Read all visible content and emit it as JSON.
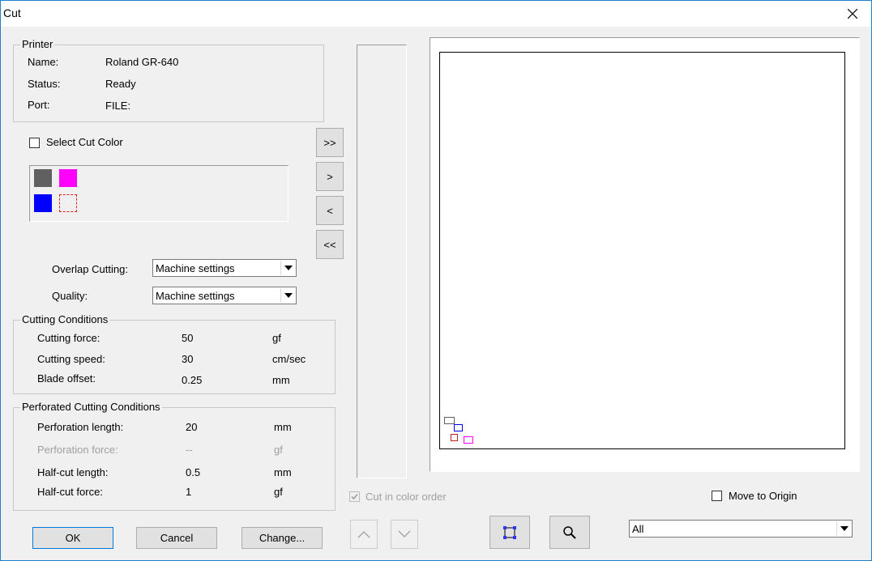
{
  "window": {
    "title": "Cut"
  },
  "printer": {
    "legend": "Printer",
    "rows": [
      {
        "label": "Name:",
        "value": "Roland GR-640"
      },
      {
        "label": "Status:",
        "value": "Ready"
      },
      {
        "label": "Port:",
        "value": "FILE:"
      }
    ]
  },
  "select_cut_color": {
    "label": "Select Cut Color",
    "checked": false
  },
  "colors": {
    "gray": "#606060",
    "magenta": "#ff00ff",
    "blue": "#0000ff",
    "dotted_red": "#e02020"
  },
  "move_buttons": {
    "all_right": ">>",
    "right": ">",
    "left": "<",
    "all_left": "<<"
  },
  "overlap_cutting": {
    "label": "Overlap Cutting:",
    "value": "Machine settings"
  },
  "quality": {
    "label": "Quality:",
    "value": "Machine settings"
  },
  "cutting_conditions": {
    "legend": "Cutting Conditions",
    "rows": [
      {
        "label": "Cutting force:",
        "value": "50",
        "unit": "gf"
      },
      {
        "label": "Cutting speed:",
        "value": "30",
        "unit": "cm/sec"
      },
      {
        "label": "Blade offset:",
        "value": "0.25",
        "unit": "mm"
      }
    ]
  },
  "perforated": {
    "legend": "Perforated Cutting Conditions",
    "rows": [
      {
        "label": "Perforation length:",
        "value": "20",
        "unit": "mm"
      },
      {
        "label": "Perforation force:",
        "value": "--",
        "unit": "gf"
      },
      {
        "label": "Half-cut length:",
        "value": "0.5",
        "unit": "mm"
      },
      {
        "label": "Half-cut force:",
        "value": "1",
        "unit": "gf"
      }
    ]
  },
  "cut_in_color_order": {
    "label": "Cut in color order",
    "checked": true,
    "enabled": false
  },
  "move_to_origin": {
    "label": "Move to Origin",
    "checked": false
  },
  "buttons": {
    "ok": "OK",
    "cancel": "Cancel",
    "change": "Change..."
  },
  "view_select": {
    "value": "All"
  }
}
